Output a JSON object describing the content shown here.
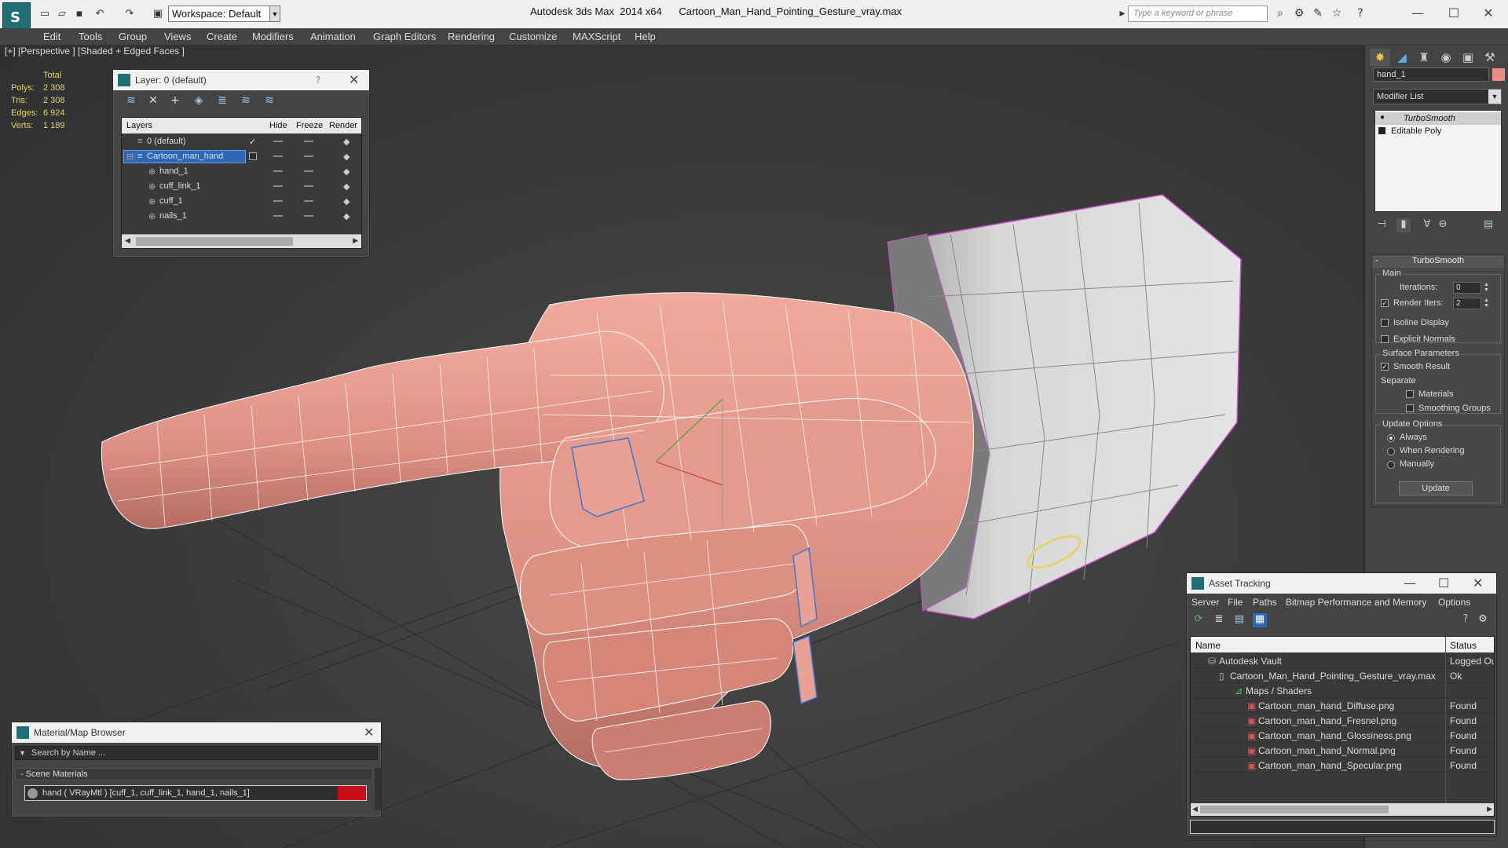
{
  "titlebar": {
    "workspace": "Workspace: Default",
    "title": "Autodesk 3ds Max  2014 x64      Cartoon_Man_Hand_Pointing_Gesture_vray.max",
    "search_placeholder": "Type a keyword or phrase"
  },
  "menu": [
    "Edit",
    "Tools",
    "Group",
    "Views",
    "Create",
    "Modifiers",
    "Animation",
    "Graph Editors",
    "Rendering",
    "Customize",
    "MAXScript",
    "Help"
  ],
  "viewport": {
    "label": "[+] [Perspective ] [Shaded + Edged Faces ]",
    "stats": {
      "total_label": "Total",
      "rows": [
        {
          "k": "Polys:",
          "v": "2 308"
        },
        {
          "k": "Tris:",
          "v": "2 308"
        },
        {
          "k": "Edges:",
          "v": "6 924"
        },
        {
          "k": "Verts:",
          "v": "1 189"
        }
      ]
    }
  },
  "layer_panel": {
    "title": "Layer: 0 (default)",
    "help": "?",
    "columns": {
      "layers": "Layers",
      "hide": "Hide",
      "freeze": "Freeze",
      "render": "Render"
    },
    "rows": [
      {
        "name": "0 (default)"
      },
      {
        "name": "Cartoon_man_hand"
      },
      {
        "name": "hand_1"
      },
      {
        "name": "cuff_link_1"
      },
      {
        "name": "cuff_1"
      },
      {
        "name": "nails_1"
      }
    ]
  },
  "command_panel": {
    "object_name": "hand_1",
    "object_color": "#e98f88",
    "modifier_list": "Modifier List",
    "stack": [
      "TurboSmooth",
      "Editable Poly"
    ],
    "turbosmooth": {
      "title": "TurboSmooth",
      "main": "Main",
      "iterations_label": "Iterations:",
      "iterations": "0",
      "render_iters_label": "Render Iters:",
      "render_iters": "2",
      "isoline": "Isoline Display",
      "explicit_normals": "Explicit Normals",
      "surface_params": "Surface Parameters",
      "smooth_result": "Smooth Result",
      "separate": "Separate",
      "materials": "Materials",
      "smoothing_groups": "Smoothing Groups",
      "update_options": "Update Options",
      "always": "Always",
      "when_rendering": "When Rendering",
      "manually": "Manually",
      "update": "Update"
    }
  },
  "material_browser": {
    "title": "Material/Map Browser",
    "search_placeholder": "Search by Name ...",
    "category": "- Scene Materials",
    "item": "hand  ( VRayMtl )  [cuff_1, cuff_link_1, hand_1, nails_1]"
  },
  "asset_tracking": {
    "title": "Asset Tracking",
    "menu": [
      "Server",
      "File",
      "Paths",
      "Bitmap Performance and Memory",
      "Options"
    ],
    "columns": {
      "name": "Name",
      "status": "Status"
    },
    "rows": [
      {
        "name": "Autodesk Vault",
        "status": "Logged Out"
      },
      {
        "name": "Cartoon_Man_Hand_Pointing_Gesture_vray.max",
        "status": "Ok"
      },
      {
        "name": "Maps / Shaders",
        "status": ""
      },
      {
        "name": "Cartoon_man_hand_Diffuse.png",
        "status": "Found"
      },
      {
        "name": "Cartoon_man_hand_Fresnel.png",
        "status": "Found"
      },
      {
        "name": "Cartoon_man_hand_Glossiness.png",
        "status": "Found"
      },
      {
        "name": "Cartoon_man_hand_Normal.png",
        "status": "Found"
      },
      {
        "name": "Cartoon_man_hand_Specular.png",
        "status": "Found"
      }
    ]
  },
  "colors": {
    "hand": "#e49a8d",
    "cuff": "#d6d6d6",
    "selection": "#2d67b5",
    "stats": "#e8d36a"
  }
}
